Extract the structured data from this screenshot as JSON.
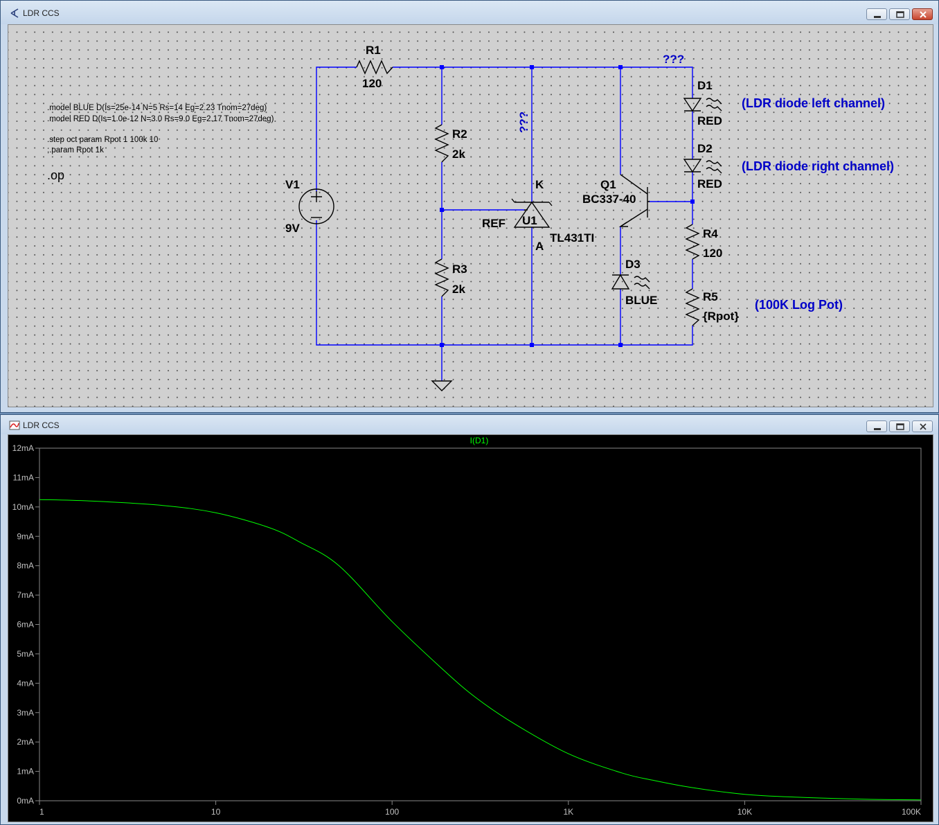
{
  "schematic_window": {
    "title": "LDR CCS",
    "directives": {
      "model_blue": ".model BLUE D(Is=25e-14 N=5 Rs=14 Eg=2.23 Tnom=27deg)",
      "model_red": ".model RED D(Is=1.0e-12 N=3.0 Rs=9.0 Eg=2.17 Tnom=27deg)",
      "step": ".step oct param Rpot 1 100k 10",
      "param": ";.param Rpot 1k",
      "op": ".op"
    },
    "components": {
      "r1_name": "R1",
      "r1_value": "120",
      "r2_name": "R2",
      "r2_value": "2k",
      "r3_name": "R3",
      "r3_value": "2k",
      "r4_name": "R4",
      "r4_value": "120",
      "r5_name": "R5",
      "r5_value": "{Rpot}",
      "v1_name": "V1",
      "v1_value": "9V",
      "u1_name": "U1",
      "u1_value": "TL431TI",
      "u1_pin_k": "K",
      "u1_pin_a": "A",
      "u1_pin_ref": "REF",
      "q1_name": "Q1",
      "q1_value": "BC337-40",
      "d1_name": "D1",
      "d1_value": "RED",
      "d2_name": "D2",
      "d2_value": "RED",
      "d3_name": "D3",
      "d3_value": "BLUE"
    },
    "net_labels": {
      "top_right": "???",
      "k_node": "???"
    },
    "comments": {
      "d1": "(LDR diode left channel)",
      "d2": "(LDR diode right channel)",
      "r5": "(100K Log Pot)"
    },
    "colors": {
      "wire": "#0000ff",
      "component": "#000000",
      "comment": "#0000c8",
      "background": "#d0d0d0"
    }
  },
  "plot_window": {
    "title": "LDR CCS",
    "trace_label": "I(D1)",
    "colors": {
      "background": "#000000",
      "trace": "#00ff00",
      "axis": "#888888",
      "text": "#c0c0c0"
    },
    "chart_data": {
      "type": "line",
      "series": [
        {
          "name": "I(D1)",
          "x": [
            1,
            2,
            5,
            10,
            20,
            30,
            50,
            100,
            200,
            300,
            500,
            1000,
            2000,
            3000,
            5000,
            10000,
            20000,
            50000,
            100000
          ],
          "y": [
            10.25,
            10.2,
            10.05,
            9.8,
            9.3,
            8.8,
            8.0,
            6.1,
            4.4,
            3.5,
            2.6,
            1.6,
            0.95,
            0.7,
            0.45,
            0.22,
            0.12,
            0.05,
            0.03
          ]
        }
      ],
      "x_scale": "log",
      "xlim": [
        1,
        100000
      ],
      "ylim": [
        0,
        12
      ],
      "x_ticks": [
        "1",
        "10",
        "100",
        "1K",
        "10K",
        "100K"
      ],
      "y_ticks": [
        "0mA",
        "1mA",
        "2mA",
        "3mA",
        "4mA",
        "5mA",
        "6mA",
        "7mA",
        "8mA",
        "9mA",
        "10mA",
        "11mA",
        "12mA"
      ]
    }
  }
}
